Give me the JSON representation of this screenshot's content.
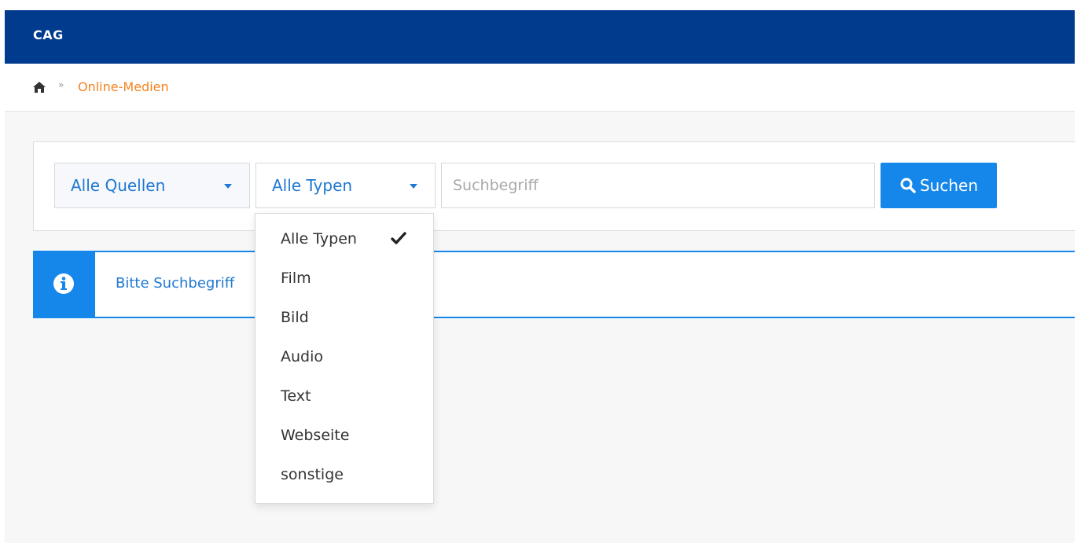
{
  "app": {
    "brand": "CAG"
  },
  "breadcrumb": {
    "home_icon": "home-icon",
    "separator": "»",
    "current": "Online-Medien"
  },
  "search": {
    "source_select": {
      "selected": "Alle Quellen"
    },
    "type_select": {
      "selected": "Alle Typen",
      "open": true
    },
    "input": {
      "value": "",
      "placeholder": "Suchbegriff"
    },
    "button": {
      "label": "Suchen",
      "icon": "search-icon"
    }
  },
  "info": {
    "icon": "info-circle-icon",
    "message": "Bitte Suchbegriff"
  },
  "dropdown": {
    "items": [
      {
        "label": "Alle Typen",
        "checked": true
      },
      {
        "label": "Film",
        "checked": false
      },
      {
        "label": "Bild",
        "checked": false
      },
      {
        "label": "Audio",
        "checked": false
      },
      {
        "label": "Text",
        "checked": false
      },
      {
        "label": "Webseite",
        "checked": false
      },
      {
        "label": "sonstige",
        "checked": false
      }
    ]
  },
  "colors": {
    "topbar": "#003b8e",
    "primary": "#1587ea",
    "link": "#1f78d1",
    "breadcrumb_active": "#f58220",
    "background": "#f7f7f7"
  }
}
